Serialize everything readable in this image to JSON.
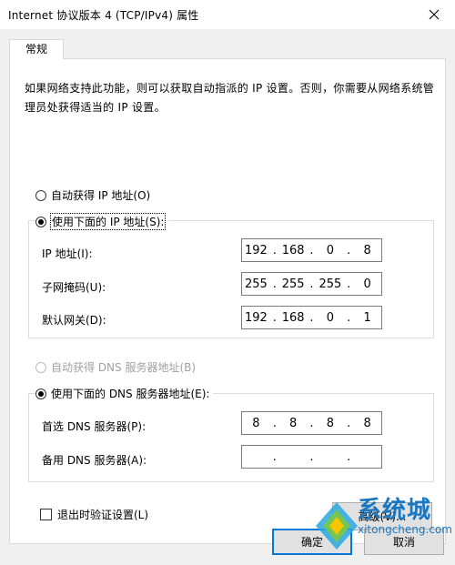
{
  "window": {
    "title": "Internet 协议版本 4 (TCP/IPv4) 属性"
  },
  "tab": {
    "label": "常规"
  },
  "intro_text": "如果网络支持此功能，则可以获取自动指派的 IP 设置。否则，你需要从网络系统管理员处获得适当的 IP 设置。",
  "ip_section": {
    "auto_label": "自动获得 IP 地址(O)",
    "manual_label": "使用下面的 IP 地址(S):",
    "fields": [
      {
        "label": "IP 地址(I):",
        "octets": [
          "192",
          "168",
          "0",
          "8"
        ]
      },
      {
        "label": "子网掩码(U):",
        "octets": [
          "255",
          "255",
          "255",
          "0"
        ]
      },
      {
        "label": "默认网关(D):",
        "octets": [
          "192",
          "168",
          "0",
          "1"
        ]
      }
    ]
  },
  "dns_section": {
    "auto_label": "自动获得 DNS 服务器地址(B)",
    "manual_label": "使用下面的 DNS 服务器地址(E):",
    "fields": [
      {
        "label": "首选 DNS 服务器(P):",
        "octets": [
          "8",
          "8",
          "8",
          "8"
        ]
      },
      {
        "label": "备用 DNS 服务器(A):",
        "octets": [
          "",
          "",
          "",
          ""
        ]
      }
    ]
  },
  "validate_label": "退出时验证设置(L)",
  "advanced_button": "高级(V)...",
  "ok_button": "确定",
  "cancel_button": "取消",
  "watermark": {
    "brand": "系统城",
    "url": "xitongcheng.com"
  }
}
